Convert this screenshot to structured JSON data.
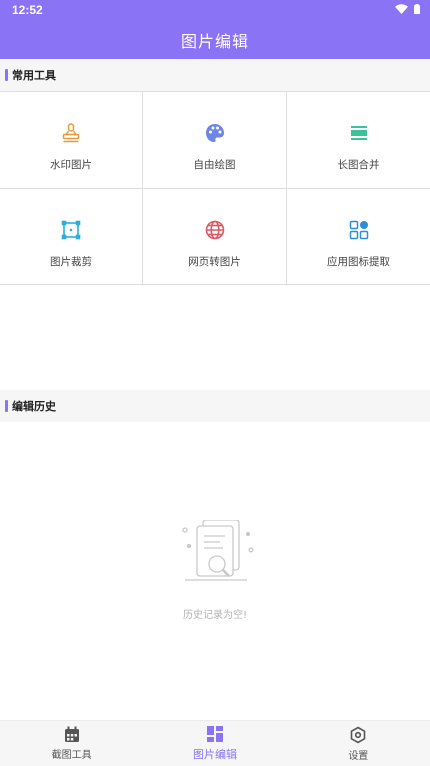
{
  "status": {
    "time": "12:52"
  },
  "header": {
    "title": "图片编辑"
  },
  "sections": {
    "tools_title": "常用工具",
    "history_title": "编辑历史"
  },
  "tools": [
    {
      "label": "水印图片",
      "icon": "stamp-icon",
      "color": "#e89a3c"
    },
    {
      "label": "自由绘图",
      "icon": "palette-icon",
      "color": "#6f86e6"
    },
    {
      "label": "长图合并",
      "icon": "merge-stack-icon",
      "color": "#3cc29a"
    },
    {
      "label": "图片裁剪",
      "icon": "crop-icon",
      "color": "#2ab0d8"
    },
    {
      "label": "网页转图片",
      "icon": "globe-icon",
      "color": "#d95a67"
    },
    {
      "label": "应用图标提取",
      "icon": "app-grid-icon",
      "color": "#2f8fd6"
    }
  ],
  "history": {
    "empty_text": "历史记录为空!"
  },
  "nav": {
    "items": [
      {
        "label": "截图工具",
        "icon": "calendar-icon"
      },
      {
        "label": "图片编辑",
        "icon": "dashboard-icon"
      },
      {
        "label": "设置",
        "icon": "settings-hex-icon"
      }
    ],
    "active_index": 1
  },
  "colors": {
    "accent": "#8b73f6",
    "section_bg": "#f6f6f7"
  }
}
